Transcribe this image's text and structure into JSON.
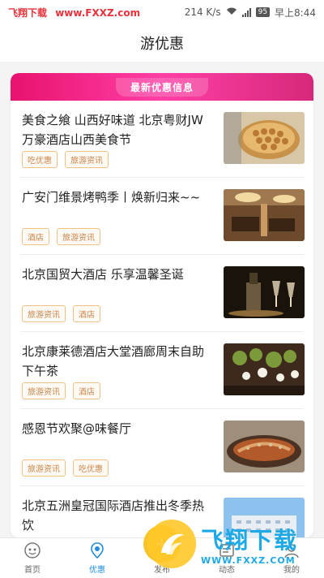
{
  "status_bar": {
    "watermark_site": "飞翔下载",
    "watermark_url": "www.FXXZ.com",
    "net_speed": "214 K/s",
    "battery": "95",
    "time": "早上8:44"
  },
  "header": {
    "title": "游优惠"
  },
  "banner": {
    "label": "最新优惠信息"
  },
  "items": [
    {
      "title": "美食之飨 山西好味道 北京粤财JW万豪酒店山西美食节",
      "tags": [
        "吃优惠",
        "旅游资讯"
      ]
    },
    {
      "title": "广安门维景烤鸭季丨焕新归来~~",
      "tags": [
        "酒店",
        "旅游资讯"
      ]
    },
    {
      "title": "北京国贸大酒店 乐享温馨圣诞",
      "tags": [
        "旅游资讯",
        "酒店"
      ]
    },
    {
      "title": "北京康莱德酒店大堂酒廊周末自助下午茶",
      "tags": [
        "旅游资讯",
        "酒店"
      ]
    },
    {
      "title": "感恩节欢聚@味餐厅",
      "tags": [
        "旅游资讯",
        "吃优惠"
      ]
    },
    {
      "title": "北京五洲皇冠国际酒店推出冬季热饮",
      "tags": []
    }
  ],
  "tab_bar": {
    "tabs": [
      {
        "label": "首页",
        "icon": "home-icon"
      },
      {
        "label": "优惠",
        "icon": "discount-icon"
      },
      {
        "label": "发布",
        "icon": "publish-icon"
      },
      {
        "label": "动态",
        "icon": "feed-icon"
      },
      {
        "label": "我的",
        "icon": "profile-icon"
      }
    ],
    "active_index": 1
  },
  "logo_overlay": {
    "text": "飞翔下载",
    "url": "WWW.FXXZ.COM"
  },
  "colors": {
    "accent": "#1e8de0",
    "banner": "#e8126f",
    "tag_border": "#f0c089",
    "tag_text": "#c8854d"
  }
}
